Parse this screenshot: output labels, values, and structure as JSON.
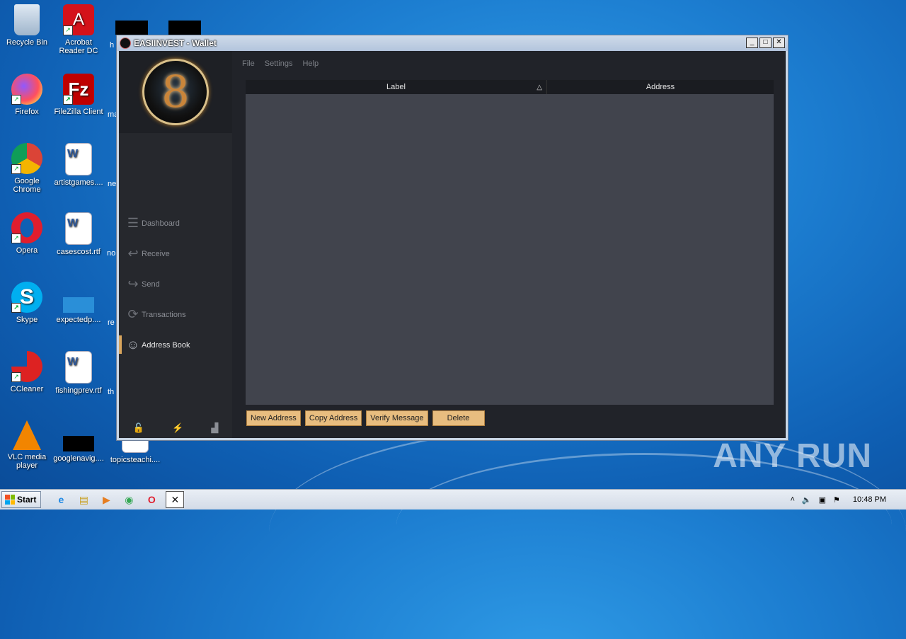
{
  "desktop": {
    "icons": [
      {
        "label": "Recycle Bin",
        "icon": "recycle-bin-icon"
      },
      {
        "label": "Acrobat Reader DC",
        "icon": "acrobat-icon"
      },
      {
        "label": "Firefox",
        "icon": "firefox-icon"
      },
      {
        "label": "FileZilla Client",
        "icon": "filezilla-icon"
      },
      {
        "label": "Google Chrome",
        "icon": "chrome-icon"
      },
      {
        "label": "artistgames....",
        "icon": "word-doc-icon"
      },
      {
        "label": "Opera",
        "icon": "opera-icon"
      },
      {
        "label": "casescost.rtf",
        "icon": "word-doc-icon"
      },
      {
        "label": "Skype",
        "icon": "skype-icon"
      },
      {
        "label": "expectedp....",
        "icon": "file-icon"
      },
      {
        "label": "CCleaner",
        "icon": "ccleaner-icon"
      },
      {
        "label": "fishingprev.rtf",
        "icon": "word-doc-icon"
      },
      {
        "label": "VLC media player",
        "icon": "vlc-icon"
      },
      {
        "label": "googlenavig....",
        "icon": "file-icon"
      },
      {
        "label": "topicsteachi....",
        "icon": "file-icon"
      }
    ],
    "partial_labels": [
      "h",
      "ma",
      "ne",
      "no",
      "re",
      "th"
    ],
    "watermark": "ANY RUN"
  },
  "window": {
    "title": "EASIINVEST - Wallet",
    "controls": {
      "minimize": "_",
      "maximize": "□",
      "close": "✕"
    },
    "logo_glyph": "8",
    "menu": [
      "File",
      "Settings",
      "Help"
    ],
    "nav": [
      {
        "label": "Dashboard",
        "icon": "dashboard-icon",
        "glyph": "☰",
        "active": false
      },
      {
        "label": "Receive",
        "icon": "receive-icon",
        "glyph": "↩",
        "active": false
      },
      {
        "label": "Send",
        "icon": "send-icon",
        "glyph": "↪",
        "active": false
      },
      {
        "label": "Transactions",
        "icon": "transactions-icon",
        "glyph": "⟳",
        "active": false
      },
      {
        "label": "Address Book",
        "icon": "address-book-icon",
        "glyph": "☺",
        "active": true
      }
    ],
    "footer_icons": [
      {
        "icon": "lock-icon",
        "glyph": "🔓"
      },
      {
        "icon": "lightning-icon",
        "glyph": "⚡"
      },
      {
        "icon": "signal-icon",
        "glyph": "▟"
      }
    ],
    "table": {
      "columns": [
        {
          "label": "Label",
          "sort": "△"
        },
        {
          "label": "Address"
        }
      ]
    },
    "buttons": [
      "New Address",
      "Copy Address",
      "Verify Message",
      "Delete"
    ]
  },
  "taskbar": {
    "start_label": "Start",
    "clock": "10:48 PM",
    "pinned": [
      {
        "icon": "ie-icon",
        "glyph": "e"
      },
      {
        "icon": "explorer-icon",
        "glyph": "▤"
      },
      {
        "icon": "media-player-icon",
        "glyph": "▶"
      },
      {
        "icon": "chrome-icon",
        "glyph": "◉"
      },
      {
        "icon": "opera-icon",
        "glyph": "O"
      },
      {
        "icon": "wallet-app-icon",
        "glyph": "✕"
      }
    ]
  },
  "colors": {
    "accent": "#e8bd7f",
    "sidebar_bg": "#26282d",
    "table_bg": "#41444d"
  }
}
